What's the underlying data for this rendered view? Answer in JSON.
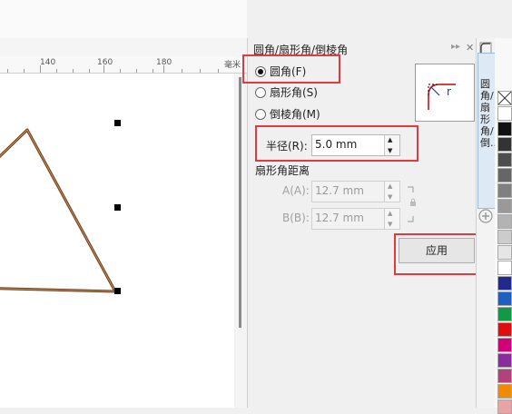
{
  "ruler": {
    "labels": [
      "140",
      "160",
      "180"
    ],
    "unit": "毫米"
  },
  "panel": {
    "title": "圆角/扇形角/倒棱角",
    "corner_options": [
      {
        "label": "圆角(F)",
        "selected": true
      },
      {
        "label": "扇形角(S)",
        "selected": false
      },
      {
        "label": "倒棱角(M)",
        "selected": false
      }
    ],
    "radius": {
      "label": "半径(R):",
      "value": "5.0 mm"
    },
    "distance_group_label": "扇形角距离",
    "distance_a": {
      "label": "A(A):",
      "value": "12.7 mm"
    },
    "distance_b": {
      "label": "B(B):",
      "value": "12.7 mm"
    },
    "apply_label": "应用",
    "preview_glyph": "r"
  },
  "docker_tab": {
    "label": "圆角/扇形角/倒..."
  },
  "colors": {
    "accent_red": "#e0393e",
    "triangle_stroke": "#6b3a1f",
    "palette": [
      "#ffffff",
      "#111111",
      "#333333",
      "#4d4d4d",
      "#666666",
      "#808080",
      "#999999",
      "#b3b3b3",
      "#cccccc",
      "#e6e6e6",
      "#ffffff",
      "#1f2a8c",
      "#1e5fc2",
      "#119a45",
      "#e10e0e",
      "#d4007a",
      "#8a2d9c",
      "#b2437a",
      "#f08a00",
      "#e8a4a4"
    ]
  }
}
